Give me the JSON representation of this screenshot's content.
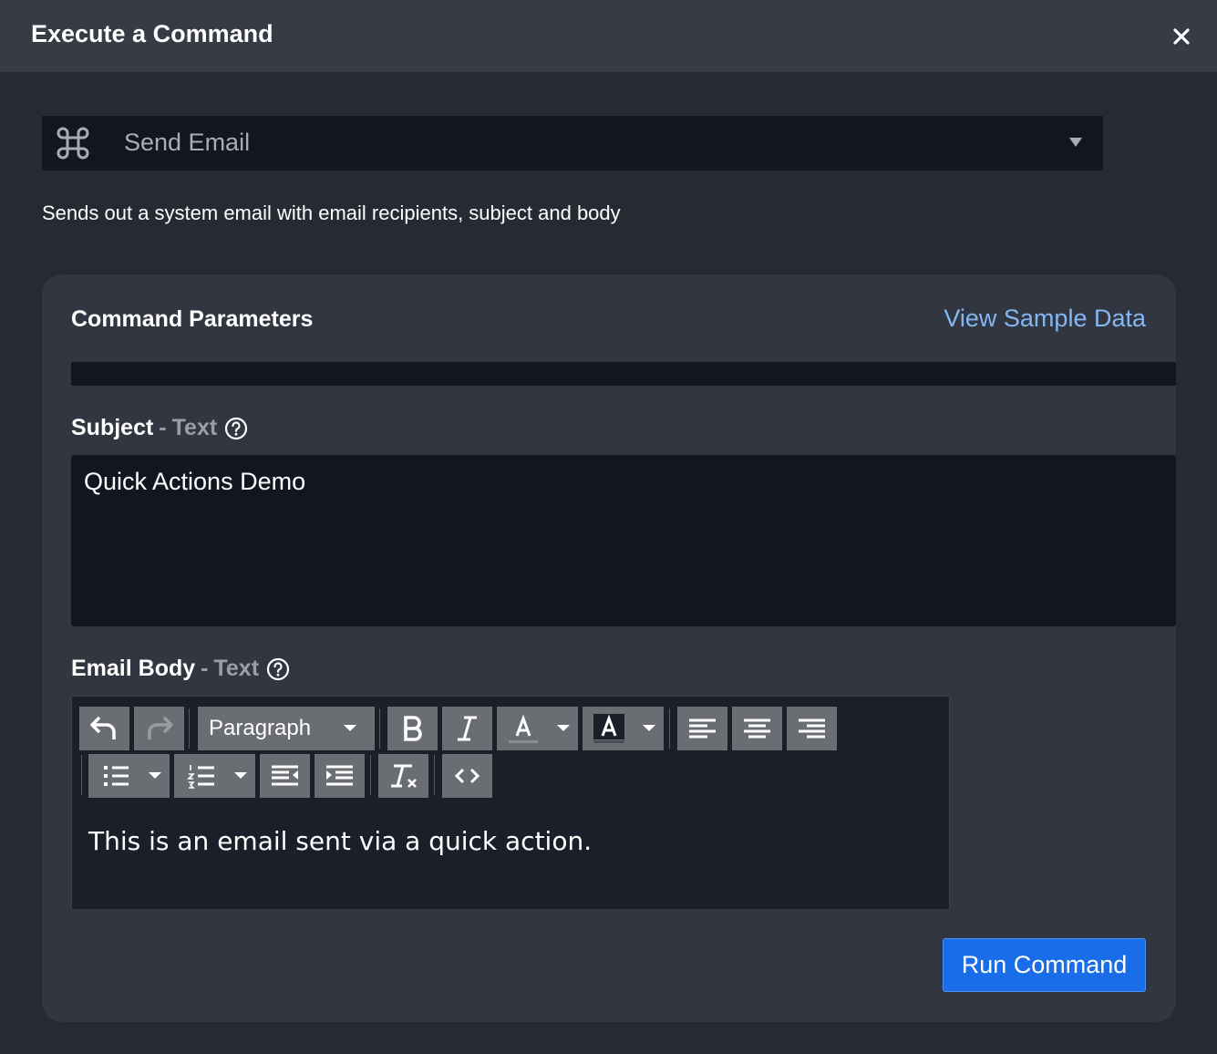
{
  "dialog": {
    "title": "Execute a Command"
  },
  "command_select": {
    "value": "Send Email",
    "icon": "command-icon"
  },
  "description": "Sends out a system email with email recipients, subject and body",
  "parameters": {
    "title": "Command Parameters",
    "sample_link": "View Sample Data",
    "subject": {
      "label": "Subject",
      "separator": "-",
      "type": "Text",
      "value": "Quick Actions Demo"
    },
    "email_body": {
      "label": "Email Body",
      "separator": "-",
      "type": "Text",
      "block_format": "Paragraph",
      "value": "This is an email sent via a quick action."
    }
  },
  "actions": {
    "run_label": "Run Command"
  },
  "colors": {
    "accent": "#1a6de8",
    "link": "#84b7f2"
  }
}
